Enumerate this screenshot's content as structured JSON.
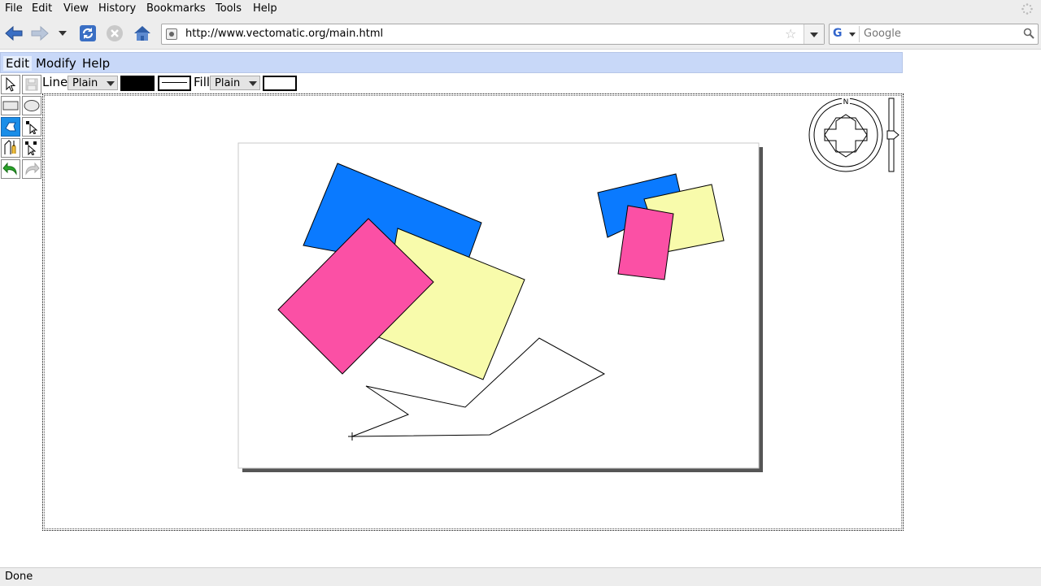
{
  "browser": {
    "menu": [
      "File",
      "Edit",
      "View",
      "History",
      "Bookmarks",
      "Tools",
      "Help"
    ],
    "url": "http://www.vectomatic.org/main.html",
    "search_placeholder": "Google",
    "status": "Done"
  },
  "app": {
    "menu": [
      "Edit",
      "Modify",
      "Help"
    ],
    "style_toolbar": {
      "line_label": "Line",
      "line_style": "Plain",
      "line_color": "#000000",
      "fill_label": "Fill",
      "fill_style": "Plain",
      "fill_color": "#ffffff"
    },
    "tools": [
      "select-icon",
      "save-icon",
      "rectangle-icon",
      "ellipse-icon",
      "polyline-icon",
      "edit-points-icon",
      "pen-icon",
      "transform-icon",
      "undo-icon",
      "redo-icon"
    ],
    "compass_label": "N",
    "colors": {
      "blue": "#0a7aff",
      "yellow": "#f8fbab",
      "pink": "#fb50a5",
      "app_menu_bg": "#c8d8f8"
    }
  }
}
